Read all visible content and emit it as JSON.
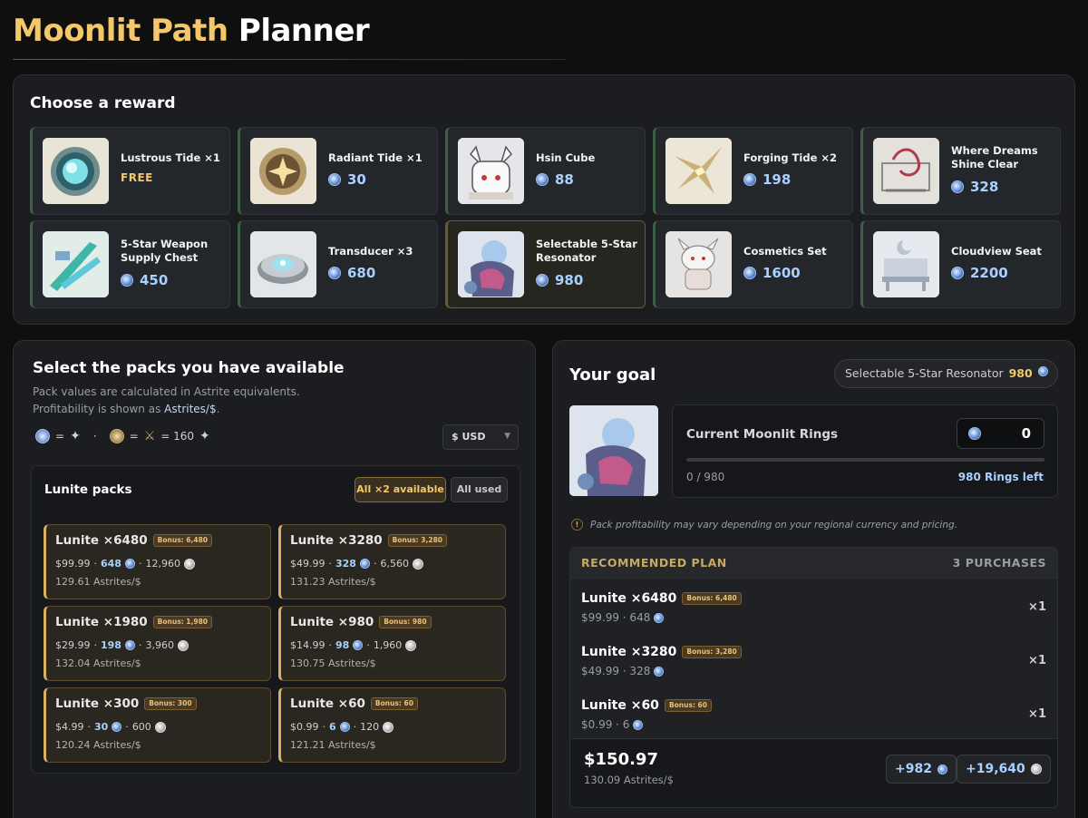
{
  "title": {
    "part1": "Moonlit Path",
    "part2": "Planner"
  },
  "rewards": {
    "heading": "Choose a reward",
    "items": [
      {
        "name": "Lustrous Tide ×1",
        "price": "FREE"
      },
      {
        "name": "Radiant Tide ×1",
        "price": "30"
      },
      {
        "name": "Hsin Cube",
        "price": "88"
      },
      {
        "name": "Forging Tide ×2",
        "price": "198"
      },
      {
        "name": "Where Dreams Shine Clear",
        "price": "328"
      },
      {
        "name": "5-Star Weapon Supply Chest",
        "price": "450"
      },
      {
        "name": "Transducer ×3",
        "price": "680"
      },
      {
        "name": "Selectable 5-Star Resonator",
        "price": "980"
      },
      {
        "name": "Cosmetics Set",
        "price": "1600"
      },
      {
        "name": "Cloudview Seat",
        "price": "2200"
      }
    ]
  },
  "packs": {
    "heading": "Select the packs you have available",
    "sub1": "Pack values are calculated in Astrite equivalents.",
    "sub2_prefix": "Profitability is shown as ",
    "sub2_hl": "Astrites/$",
    "sub2_suffix": ".",
    "eq_equals": "=",
    "eq_dot": "·",
    "eq_value": "= 160",
    "currency": "$ USD",
    "group_title": "Lunite packs",
    "btn_available": "All ×2 available",
    "btn_used": "All used",
    "items": [
      {
        "name": "Lunite ×6480",
        "bonus": "Bonus: 6,480",
        "price": "$99.99",
        "rings": "648",
        "astrites": "12,960",
        "ratio": "129.61 Astrites/$"
      },
      {
        "name": "Lunite ×3280",
        "bonus": "Bonus: 3,280",
        "price": "$49.99",
        "rings": "328",
        "astrites": "6,560",
        "ratio": "131.23 Astrites/$"
      },
      {
        "name": "Lunite ×1980",
        "bonus": "Bonus: 1,980",
        "price": "$29.99",
        "rings": "198",
        "astrites": "3,960",
        "ratio": "132.04 Astrites/$"
      },
      {
        "name": "Lunite ×980",
        "bonus": "Bonus: 980",
        "price": "$14.99",
        "rings": "98",
        "astrites": "1,960",
        "ratio": "130.75 Astrites/$"
      },
      {
        "name": "Lunite ×300",
        "bonus": "Bonus: 300",
        "price": "$4.99",
        "rings": "30",
        "astrites": "600",
        "ratio": "120.24 Astrites/$"
      },
      {
        "name": "Lunite ×60",
        "bonus": "Bonus: 60",
        "price": "$0.99",
        "rings": "6",
        "astrites": "120",
        "ratio": "121.21 Astrites/$"
      }
    ]
  },
  "goal": {
    "heading": "Your goal",
    "target_name": "Selectable 5-Star Resonator",
    "target_price": "980",
    "rings_label": "Current Moonlit Rings",
    "rings_value": "0",
    "progress_fraction": 0,
    "progress_text": "0 / 980",
    "rings_left": "980 Rings left",
    "note": "Pack profitability may vary depending on your regional currency and pricing.",
    "note_icon": "!"
  },
  "plan": {
    "heading": "RECOMMENDED PLAN",
    "count": "3 PURCHASES",
    "rows": [
      {
        "name": "Lunite ×6480",
        "bonus": "Bonus: 6,480",
        "sub": "$99.99 · 648",
        "qty": "×1"
      },
      {
        "name": "Lunite ×3280",
        "bonus": "Bonus: 3,280",
        "sub": "$49.99 · 328",
        "qty": "×1"
      },
      {
        "name": "Lunite ×60",
        "bonus": "Bonus: 60",
        "sub": "$0.99 · 6",
        "qty": "×1"
      }
    ],
    "total": "$150.97",
    "total_ratio": "130.09 Astrites/$",
    "chip_rings": "+982",
    "chip_astrites": "+19,640"
  },
  "colors": {
    "accent": "#f4c86a",
    "ring_blue": "#a9d1ff",
    "background": "#0f0f10"
  },
  "icons": {
    "ring": "moonlit-ring-icon",
    "astrite": "astrite-icon",
    "chevron": "chevron-down-icon",
    "alert": "alert-icon"
  }
}
